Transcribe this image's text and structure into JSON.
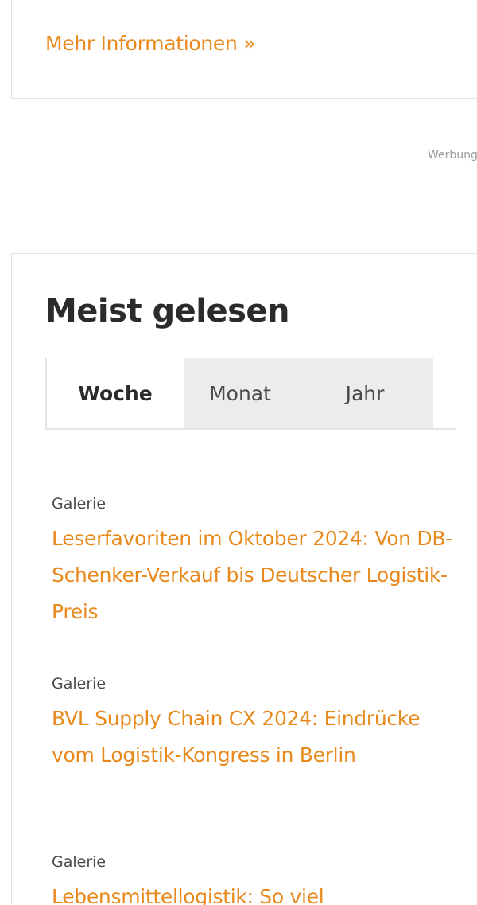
{
  "info_card": {
    "more_link_label": "Mehr Informationen »"
  },
  "ad": {
    "label": "Werbung"
  },
  "most_read": {
    "title": "Meist gelesen",
    "tabs": [
      {
        "label": "Woche",
        "active": true
      },
      {
        "label": "Monat",
        "active": false
      },
      {
        "label": "Jahr",
        "active": false
      }
    ],
    "articles": [
      {
        "category": "Galerie",
        "title": "Leserfavoriten im Oktober 2024: Von DB-Schenker-Verkauf bis Deutscher Logistik-Preis"
      },
      {
        "category": "Galerie",
        "title": "BVL Supply Chain CX 2024: Eindrücke vom Logistik-Kongress in Berlin"
      },
      {
        "category": "Galerie",
        "title": "Lebensmittellogistik: So viel"
      }
    ]
  },
  "colors": {
    "accent": "#e8891c",
    "text": "#2b2b2b",
    "muted": "#9a9a9a",
    "tab_inactive_bg": "#ececec",
    "border": "#e2e2e2"
  }
}
